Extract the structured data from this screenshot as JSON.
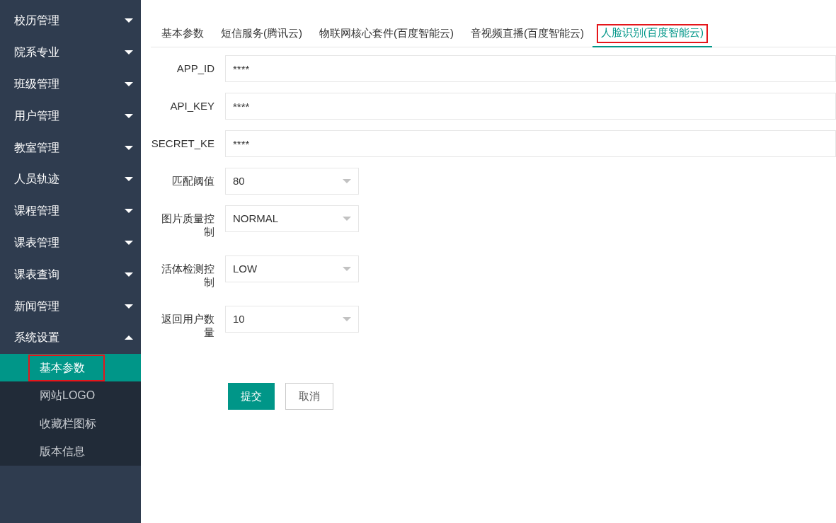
{
  "sidebar": {
    "items": [
      {
        "label": "校历管理",
        "expanded": false
      },
      {
        "label": "院系专业",
        "expanded": false
      },
      {
        "label": "班级管理",
        "expanded": false
      },
      {
        "label": "用户管理",
        "expanded": false
      },
      {
        "label": "教室管理",
        "expanded": false
      },
      {
        "label": "人员轨迹",
        "expanded": false
      },
      {
        "label": "课程管理",
        "expanded": false
      },
      {
        "label": "课表管理",
        "expanded": false
      },
      {
        "label": "课表查询",
        "expanded": false
      },
      {
        "label": "新闻管理",
        "expanded": false
      },
      {
        "label": "系统设置",
        "expanded": true,
        "children": [
          {
            "label": "基本参数",
            "selected": true,
            "highlighted": true
          },
          {
            "label": "网站LOGO",
            "selected": false,
            "highlighted": false
          },
          {
            "label": "收藏栏图标",
            "selected": false,
            "highlighted": false
          },
          {
            "label": "版本信息",
            "selected": false,
            "highlighted": false
          }
        ]
      }
    ]
  },
  "tabs": [
    {
      "label": "基本参数",
      "selected": false,
      "highlighted": false
    },
    {
      "label": "短信服务(腾讯云)",
      "selected": false,
      "highlighted": false
    },
    {
      "label": "物联网核心套件(百度智能云)",
      "selected": false,
      "highlighted": false
    },
    {
      "label": "音视频直播(百度智能云)",
      "selected": false,
      "highlighted": false
    },
    {
      "label": "人脸识别(百度智能云)",
      "selected": true,
      "highlighted": true
    }
  ],
  "form": {
    "fields": [
      {
        "kind": "text",
        "label": "APP_ID",
        "value": "****"
      },
      {
        "kind": "text",
        "label": "API_KEY",
        "value": "****"
      },
      {
        "kind": "text",
        "label": "SECRET_KE",
        "value": "****"
      },
      {
        "kind": "select",
        "label": "匹配阈值",
        "value": "80"
      },
      {
        "kind": "select",
        "label": "图片质量控制",
        "value": "NORMAL"
      },
      {
        "kind": "select",
        "label": "活体检测控制",
        "value": "LOW"
      },
      {
        "kind": "select",
        "label": "返回用户数量",
        "value": "10"
      }
    ],
    "buttons": [
      {
        "kind": "primary",
        "label": "提交"
      },
      {
        "kind": "default",
        "label": "取消"
      }
    ]
  }
}
